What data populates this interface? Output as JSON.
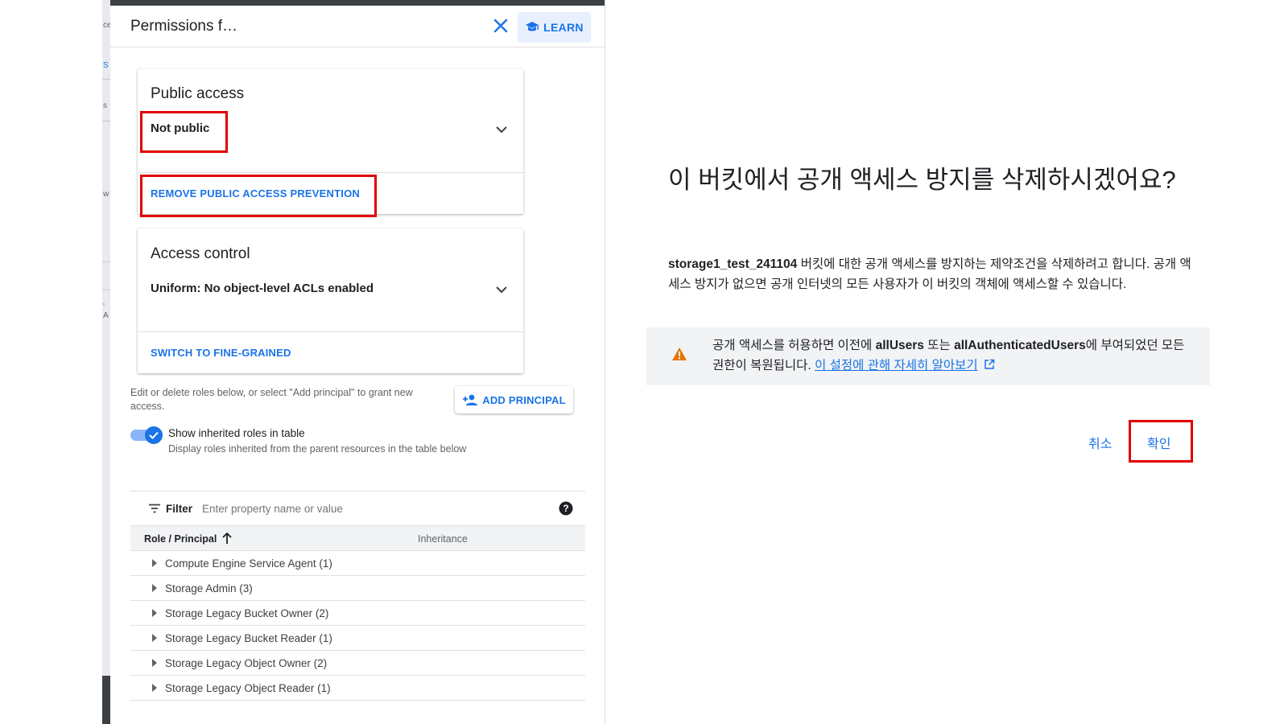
{
  "backdrop": {
    "fragments": [
      "ce",
      "S",
      "s",
      "w",
      "' A"
    ]
  },
  "panel": {
    "title": "Permissions f…",
    "learn_label": "LEARN",
    "public_access": {
      "title": "Public access",
      "value": "Not public",
      "action": "REMOVE PUBLIC ACCESS PREVENTION"
    },
    "access_control": {
      "title": "Access control",
      "value": "Uniform: No object-level ACLs enabled",
      "action": "SWITCH TO FINE-GRAINED"
    },
    "help_text": "Edit or delete roles below, or select \"Add principal\" to grant new access.",
    "add_principal_label": "ADD PRINCIPAL",
    "toggle": {
      "label": "Show inherited roles in table",
      "sub": "Display roles inherited from the parent resources in the table below",
      "checked": true
    },
    "filter": {
      "label": "Filter",
      "placeholder": "Enter property name or value"
    },
    "table": {
      "columns": [
        "Role / Principal",
        "Inheritance"
      ],
      "rows": [
        "Compute Engine Service Agent (1)",
        "Storage Admin (3)",
        "Storage Legacy Bucket Owner (2)",
        "Storage Legacy Bucket Reader (1)",
        "Storage Legacy Object Owner (2)",
        "Storage Legacy Object Reader (1)"
      ]
    }
  },
  "dialog": {
    "title": "이 버킷에서 공개 액세스 방지를 삭제하시겠어요?",
    "bucket_name": "storage1_test_241104",
    "body_rest": " 버킷에 대한 공개 액세스를 방지하는 제약조건을 삭제하려고 합니다. 공개 액세스 방지가 없으면 공개 인터넷의 모든 사용자가 이 버킷의 객체에 액세스할 수 있습니다.",
    "warning": {
      "part1": "공개 액세스를 허용하면 이전에 ",
      "all_users": "allUsers",
      "part2": " 또는 ",
      "all_auth_users": "allAuthenticatedUsers",
      "part3": "에 부여되었던 모든 권한이 복원됩니다. ",
      "link": "이 설정에 관해 자세히 알아보기"
    },
    "cancel_label": "취소",
    "confirm_label": "확인"
  },
  "colors": {
    "accent": "#1a73e8",
    "highlight": "#e00000",
    "warning": "#e37400"
  }
}
